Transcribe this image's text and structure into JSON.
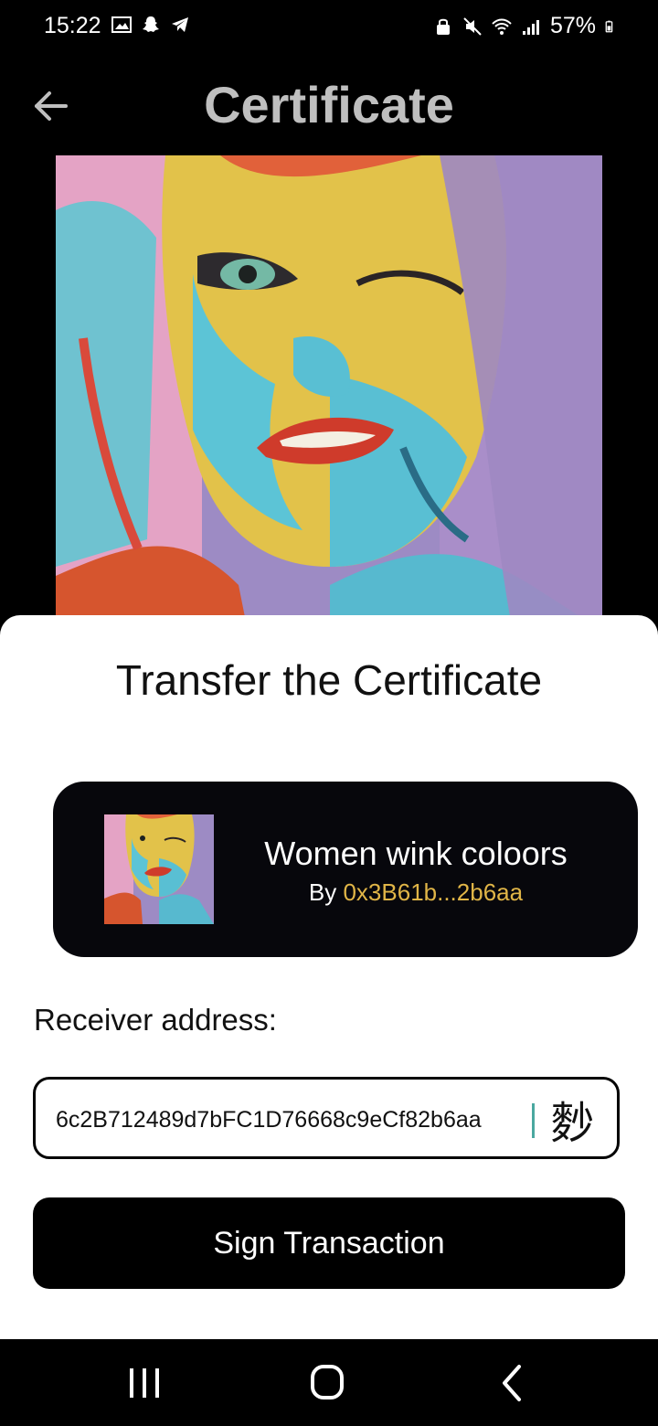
{
  "status_bar": {
    "time": "15:22",
    "battery": "57%"
  },
  "header": {
    "title": "Certificate"
  },
  "sheet": {
    "title": "Transfer the Certificate",
    "card": {
      "name": "Women wink coloors",
      "by_prefix": "By",
      "owner": "0x3B61b...2b6aa"
    },
    "receiver_label": "Receiver address:",
    "receiver_value": "6c2B712489d7bFC1D76668c9eCf82b6aa",
    "scan_glyph": "麨",
    "sign_button": "Sign Transaction"
  },
  "colors": {
    "accent_owner": "#e0b547",
    "title_gray": "#bfbfbf"
  }
}
